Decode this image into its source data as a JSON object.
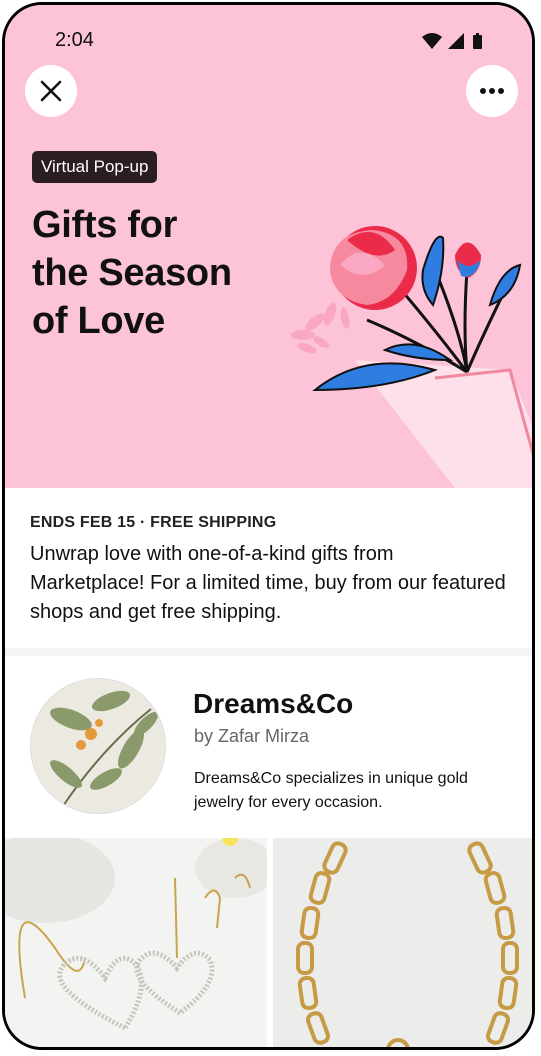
{
  "status_bar": {
    "time": "2:04"
  },
  "hero": {
    "badge": "Virtual Pop-up",
    "title_lines": [
      "Gifts for",
      "the Season",
      "of Love"
    ],
    "background": "#fdc3d8"
  },
  "event": {
    "meta": "ENDS FEB 15 · FREE SHIPPING",
    "description": "Unwrap love with one-of-a-kind gifts from Marketplace! For a limited time, buy from our featured shops and get free shipping."
  },
  "shop": {
    "name": "Dreams&Co",
    "by": "by Zafar Mirza",
    "description": "Dreams&Co specializes in unique gold jewelry for every occasion."
  },
  "icons": {
    "close": "close-icon",
    "more": "more-icon",
    "wifi": "wifi-icon",
    "signal": "signal-icon",
    "battery": "battery-icon"
  }
}
